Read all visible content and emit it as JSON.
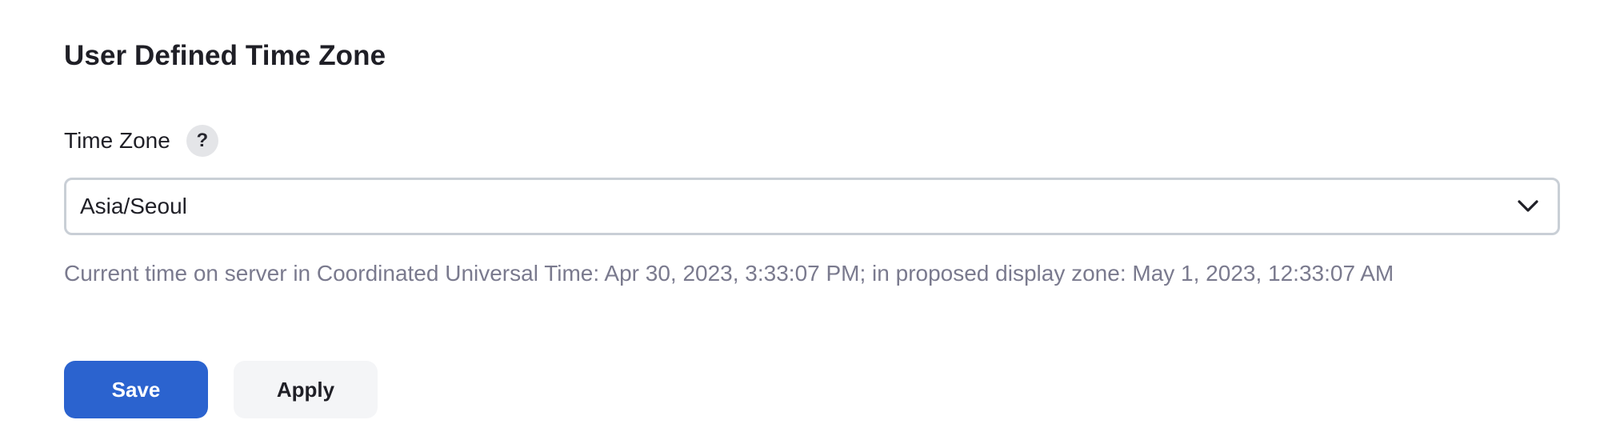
{
  "section": {
    "title": "User Defined Time Zone"
  },
  "time_zone_field": {
    "label": "Time Zone",
    "help_icon": "?",
    "selected_value": "Asia/Seoul",
    "help_text": "Current time on server in Coordinated Universal Time: Apr 30, 2023, 3:33:07 PM; in proposed display zone: May 1, 2023, 12:33:07 AM"
  },
  "actions": {
    "save_label": "Save",
    "apply_label": "Apply"
  },
  "icons": {
    "help": "question-mark-icon",
    "dropdown": "chevron-down-icon"
  },
  "colors": {
    "primary": "#2b63cf",
    "secondary_button_bg": "#f4f5f7",
    "help_text": "#7a7a8e",
    "border": "#c9cfd6"
  }
}
